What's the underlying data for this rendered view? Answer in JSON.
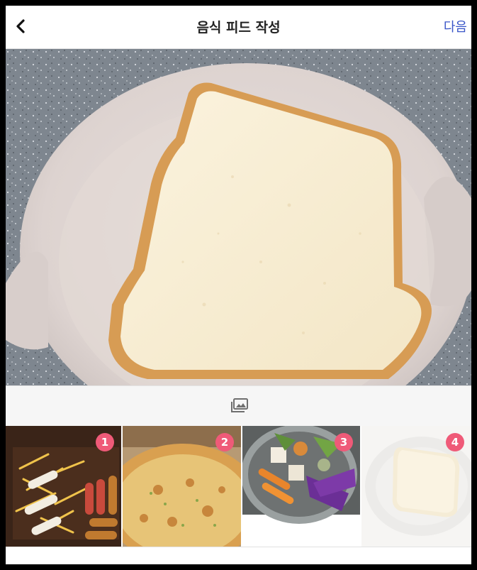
{
  "header": {
    "title": "음식 피드 작성",
    "next_label": "다음",
    "back_icon": "chevron-left-icon"
  },
  "preview": {
    "subject": "main-photo-bread"
  },
  "gallery": {
    "icon": "gallery-icon"
  },
  "thumbnails": [
    {
      "badge": "1"
    },
    {
      "badge": "2"
    },
    {
      "badge": "3"
    },
    {
      "badge": "4"
    }
  ],
  "colors": {
    "accent": "#3a56c8",
    "badge": "#ef5a78"
  }
}
